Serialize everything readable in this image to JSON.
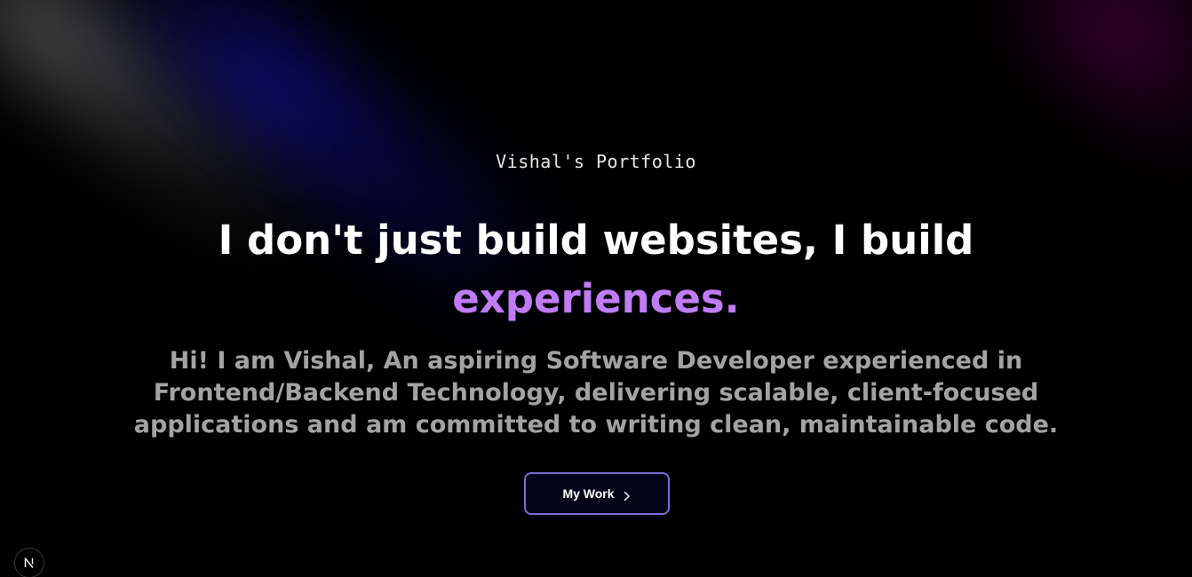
{
  "hero": {
    "subtitle": "Vishal's Portfolio",
    "headline_main": "I don't just build websites, I build",
    "headline_accent": "experiences.",
    "intro": "Hi! I am Vishal, An aspiring Software Developer experienced in Frontend/Backend Technology, delivering scalable, client-focused applications and am committed to writing clean, maintainable code."
  },
  "cta": {
    "label": "My Work",
    "icon": "chevron-right-icon"
  },
  "badge": {
    "icon": "nextjs-logo-icon",
    "glyph": "N"
  },
  "colors": {
    "background": "#000000",
    "headline": "#ffffff",
    "accent": "#c07cf6",
    "intro_text": "#a3a3a3",
    "button_border": "#7d6bd6",
    "button_bg": "#05051a"
  }
}
